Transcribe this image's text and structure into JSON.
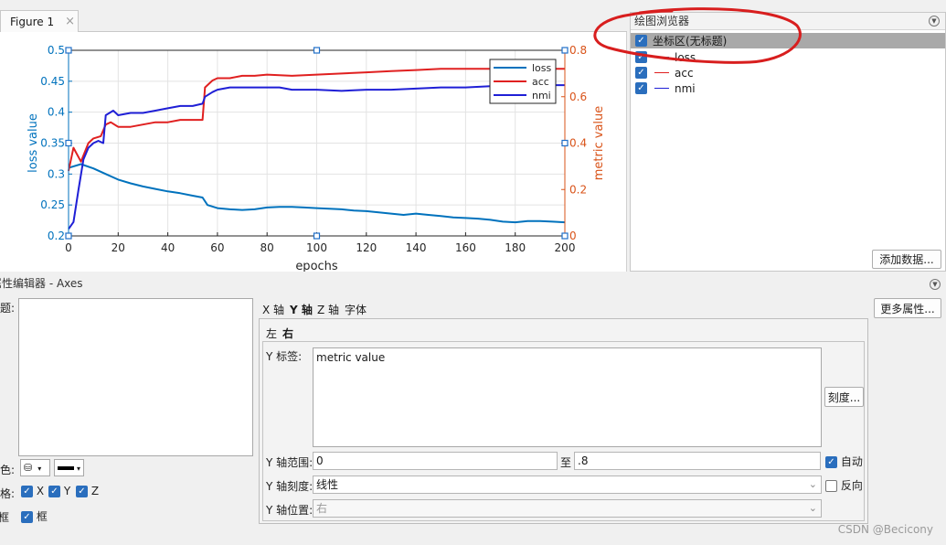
{
  "figure_tab": {
    "title": "Figure 1",
    "close": "×"
  },
  "plot_browser": {
    "title": "绘图浏览器",
    "axes_item": "坐标区(无标题)",
    "items": [
      {
        "label": "loss",
        "color": "#0072BD"
      },
      {
        "label": "acc",
        "color": "#E02020"
      },
      {
        "label": "nmi",
        "color": "#1f1fd6"
      }
    ],
    "add_data_button": "添加数据..."
  },
  "prop_editor": {
    "header": "属性编辑器 - Axes",
    "title_label": "标题:",
    "color_label": "颜色:",
    "grid_label": "网格:",
    "grid_x": "X",
    "grid_y": "Y",
    "grid_z": "Z",
    "box_label_left": "框",
    "box_label": "框",
    "more_props_button": "更多属性...",
    "axis_tabs": [
      "X 轴",
      "Y 轴",
      "Z 轴",
      "字体"
    ],
    "side_tabs": [
      "左",
      "右"
    ],
    "ylabel_label": "Y 标签:",
    "ylabel_value": "metric value",
    "ticks_button": "刻度...",
    "range_label": "Y 轴范围:",
    "range_min": "0",
    "range_to": "至",
    "range_max": ".8",
    "auto_label": "自动",
    "scale_label": "Y 轴刻度:",
    "scale_value": "线性",
    "reverse_label": "反向",
    "position_label": "Y 轴位置:",
    "position_value": "右"
  },
  "watermark": "CSDN @Becicony",
  "chart_data": {
    "type": "line",
    "xlabel": "epochs",
    "ylabel_left": "loss value",
    "ylabel_right": "metric value",
    "xlim": [
      0,
      200
    ],
    "ylim_left": [
      0.2,
      0.5
    ],
    "ylim_right": [
      0,
      0.8
    ],
    "xticks": [
      "0",
      "20",
      "40",
      "60",
      "80",
      "100",
      "120",
      "140",
      "160",
      "180",
      "200"
    ],
    "yticks_left": [
      "0.2",
      "0.25",
      "0.3",
      "0.35",
      "0.4",
      "0.45",
      "0.5"
    ],
    "yticks_right": [
      "0",
      "0.2",
      "0.4",
      "0.6",
      "0.8"
    ],
    "grid": true,
    "legend_position": "top-right",
    "series": [
      {
        "name": "loss",
        "axis": "left",
        "color": "#0072BD",
        "x": [
          0,
          5,
          10,
          15,
          20,
          25,
          30,
          35,
          40,
          45,
          50,
          54,
          56,
          60,
          65,
          70,
          75,
          80,
          85,
          90,
          95,
          100,
          105,
          110,
          115,
          120,
          125,
          130,
          135,
          140,
          145,
          150,
          155,
          160,
          165,
          170,
          175,
          180,
          185,
          190,
          195,
          200
        ],
        "y": [
          0.31,
          0.316,
          0.309,
          0.3,
          0.291,
          0.285,
          0.28,
          0.276,
          0.272,
          0.269,
          0.265,
          0.262,
          0.25,
          0.245,
          0.243,
          0.242,
          0.243,
          0.246,
          0.247,
          0.247,
          0.246,
          0.245,
          0.244,
          0.243,
          0.241,
          0.24,
          0.238,
          0.236,
          0.234,
          0.236,
          0.234,
          0.232,
          0.23,
          0.229,
          0.228,
          0.226,
          0.223,
          0.222,
          0.224,
          0.224,
          0.223,
          0.222
        ]
      },
      {
        "name": "acc",
        "axis": "right",
        "color": "#E02020",
        "x": [
          0,
          2,
          5,
          8,
          10,
          13,
          15,
          17,
          20,
          25,
          30,
          35,
          40,
          45,
          50,
          54,
          55,
          58,
          60,
          65,
          70,
          75,
          80,
          90,
          100,
          110,
          120,
          130,
          140,
          150,
          160,
          170,
          180,
          190,
          200
        ],
        "y": [
          0.28,
          0.38,
          0.32,
          0.4,
          0.42,
          0.43,
          0.48,
          0.49,
          0.47,
          0.47,
          0.48,
          0.49,
          0.49,
          0.5,
          0.5,
          0.5,
          0.64,
          0.67,
          0.68,
          0.68,
          0.69,
          0.69,
          0.695,
          0.69,
          0.695,
          0.7,
          0.705,
          0.71,
          0.715,
          0.72,
          0.72,
          0.72,
          0.72,
          0.72,
          0.72
        ]
      },
      {
        "name": "nmi",
        "axis": "right",
        "color": "#1f1fd6",
        "x": [
          0,
          2,
          4,
          6,
          8,
          10,
          12,
          14,
          15,
          18,
          20,
          25,
          30,
          35,
          40,
          45,
          50,
          54,
          55,
          58,
          60,
          65,
          70,
          75,
          80,
          85,
          90,
          100,
          110,
          120,
          130,
          140,
          150,
          160,
          170,
          180,
          190,
          200
        ],
        "y": [
          0.03,
          0.06,
          0.2,
          0.33,
          0.38,
          0.4,
          0.41,
          0.4,
          0.52,
          0.54,
          0.52,
          0.53,
          0.53,
          0.54,
          0.55,
          0.56,
          0.56,
          0.57,
          0.6,
          0.62,
          0.63,
          0.64,
          0.64,
          0.64,
          0.64,
          0.64,
          0.63,
          0.63,
          0.625,
          0.63,
          0.63,
          0.635,
          0.64,
          0.64,
          0.645,
          0.645,
          0.65,
          0.65
        ]
      }
    ]
  }
}
